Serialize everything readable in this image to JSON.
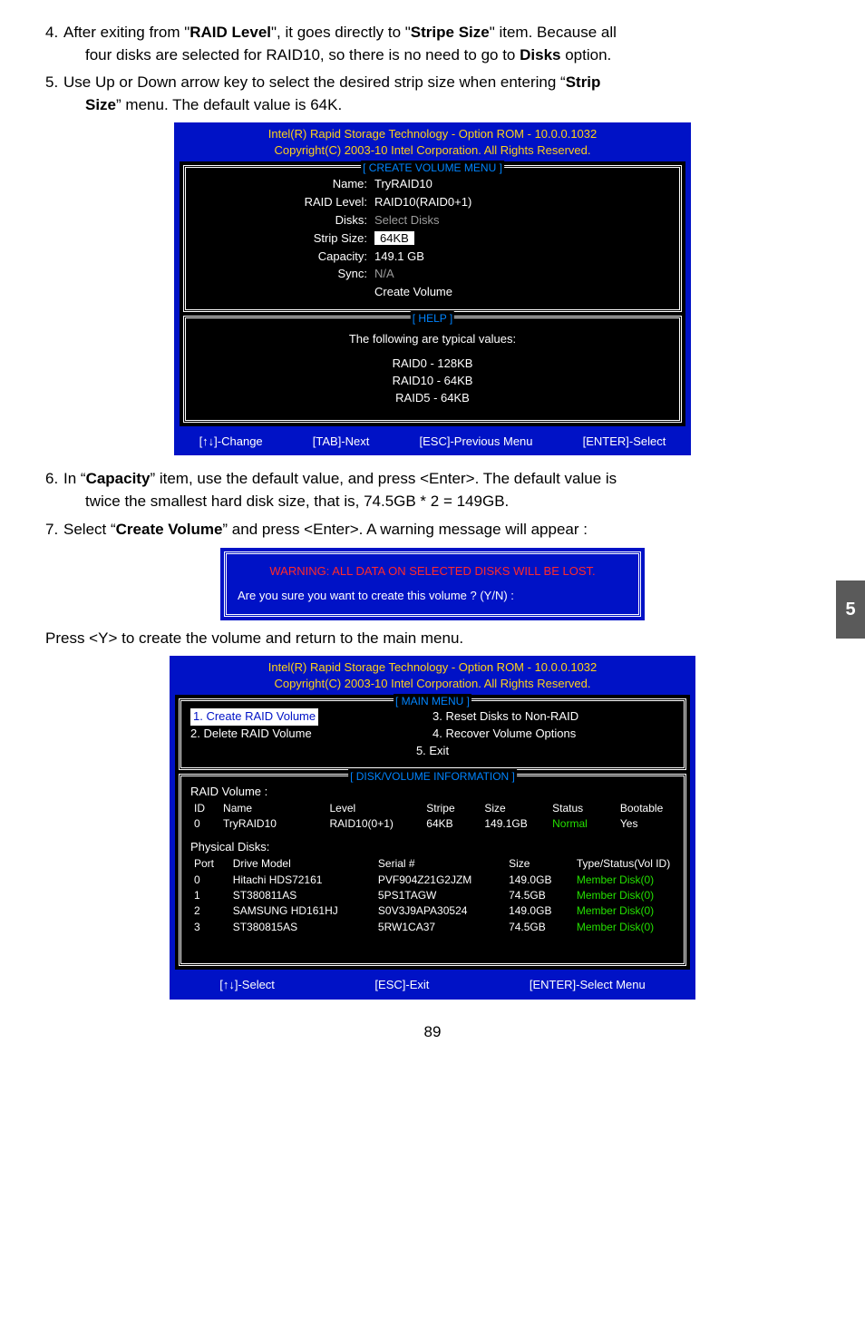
{
  "step4": {
    "num": "4.",
    "l1a": "After exiting from \"",
    "l1b": "RAID Level",
    "l1c": "\", it goes directly to \"",
    "l1d": "Stripe Size",
    "l1e": "\" item. Because all",
    "l2a": "four disks are selected for RAID10, so there is no need to go to ",
    "l2b": "Disks",
    "l2c": " option."
  },
  "step5": {
    "num": "5.",
    "l1a": "Use Up or Down arrow key to select the desired strip size when entering “",
    "l1b": "Strip",
    "l2a": "Size",
    "l2b": "” menu. The default value is 64K."
  },
  "bios1": {
    "h1": "Intel(R) Rapid Storage Technology - Option ROM - 10.0.0.1032",
    "h2": "Copyright(C) 2003-10 Intel Corporation.   All Rights Reserved.",
    "box1title": "[ CREATE VOLUME MENU ]",
    "rows": {
      "name_k": "Name:",
      "name_v": "TryRAID10",
      "level_k": "RAID Level:",
      "level_v": "RAID10(RAID0+1)",
      "disks_k": "Disks:",
      "disks_v": "Select Disks",
      "strip_k": "Strip Size:",
      "strip_v": "64KB",
      "cap_k": "Capacity:",
      "cap_v": "149.1   GB",
      "sync_k": "Sync:",
      "sync_v": "N/A",
      "create_v": "Create Volume"
    },
    "box2title": "[ HELP ]",
    "help1": "The following are typical values:",
    "help_r0": "RAID0   -  128KB",
    "help_r10": "RAID10 -  64KB",
    "help_r5": "RAID5   -  64KB",
    "f1": "[↑↓]-Change",
    "f2": "[TAB]-Next",
    "f3": "[ESC]-Previous Menu",
    "f4": "[ENTER]-Select"
  },
  "step6": {
    "num": "6.",
    "l1a": "In “",
    "l1b": "Capacity",
    "l1c": "” item, use the default value, and press <Enter>. The default value is",
    "l2": "twice the smallest hard disk size, that is, 74.5GB * 2 = 149GB."
  },
  "step7": {
    "num": "7.",
    "l1a": "Select “",
    "l1b": "Create Volume",
    "l1c": "” and press <Enter>. A warning message will appear :"
  },
  "warn": {
    "l1": "WARNING: ALL DATA ON SELECTED DISKS WILL BE LOST.",
    "l2": "Are you sure you want to create this volume ? (Y/N) :"
  },
  "afterwarn": "Press <Y> to create the volume and return to the main menu.",
  "bios2": {
    "h1": "Intel(R) Rapid Storage Technology - Option ROM - 10.0.0.1032",
    "h2": "Copyright(C) 2003-10 Intel Corporation.   All Rights Reserved.",
    "mmtitle": "[ MAIN MENU ]",
    "m1": "1. Create RAID Volume",
    "m2": "2. Delete RAID Volume",
    "m3": "3. Reset Disks to Non-RAID",
    "m4": "4. Recover Volume Options",
    "m5": "5. Exit",
    "dvtitle": "[ DISK/VOLUME INFORMATION ]",
    "rvlabel": "RAID Volume :",
    "rvh": {
      "id": "ID",
      "name": "Name",
      "level": "Level",
      "stripe": "Stripe",
      "size": "Size",
      "status": "Status",
      "boot": "Bootable"
    },
    "rv0": {
      "id": "0",
      "name": "TryRAID10",
      "level": "RAID10(0+1)",
      "stripe": "64KB",
      "size": "149.1GB",
      "status": "Normal",
      "boot": "Yes"
    },
    "pdlabel": "Physical Disks:",
    "pdh": {
      "port": "Port",
      "model": "Drive Model",
      "serial": "Serial #",
      "size": "Size",
      "type": "Type/Status(Vol ID)"
    },
    "pd": [
      {
        "port": "0",
        "model": "Hitachi HDS72161",
        "serial": "PVF904Z21G2JZM",
        "size": "149.0GB",
        "type": "Member Disk(0)"
      },
      {
        "port": "1",
        "model": "ST380811AS",
        "serial": "5PS1TAGW",
        "size": "74.5GB",
        "type": "Member Disk(0)"
      },
      {
        "port": "2",
        "model": "SAMSUNG HD161HJ",
        "serial": "S0V3J9APA30524",
        "size": "149.0GB",
        "type": "Member Disk(0)"
      },
      {
        "port": "3",
        "model": "ST380815AS",
        "serial": "5RW1CA37",
        "size": "74.5GB",
        "type": "Member Disk(0)"
      }
    ],
    "f1": "[↑↓]-Select",
    "f2": "[ESC]-Exit",
    "f3": "[ENTER]-Select Menu"
  },
  "sidetab": "5",
  "pagenum": "89"
}
